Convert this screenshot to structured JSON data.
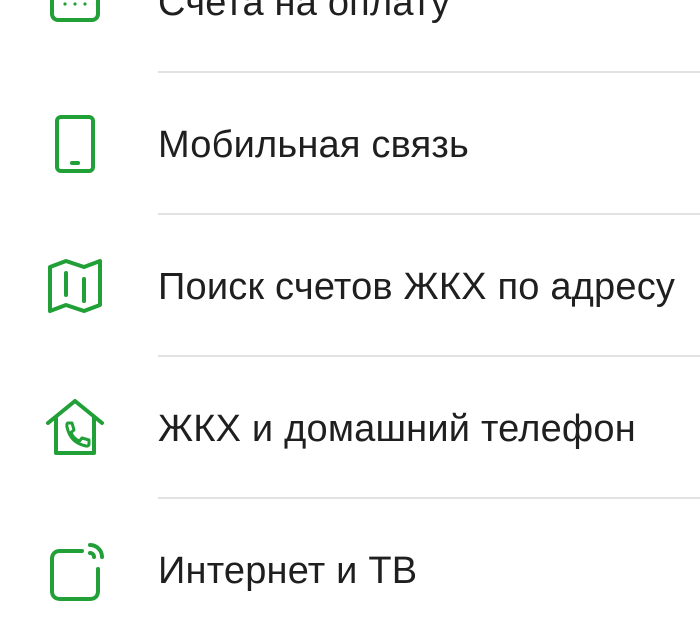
{
  "accent_color": "#21a038",
  "menu": {
    "items": [
      {
        "label": "Счета на оплату",
        "icon": "invoice-icon"
      },
      {
        "label": "Мобильная связь",
        "icon": "mobile-phone-icon"
      },
      {
        "label": "Поиск счетов ЖКХ по адресу",
        "icon": "map-icon"
      },
      {
        "label": "ЖКХ и домашний телефон",
        "icon": "house-phone-icon"
      },
      {
        "label": "Интернет и ТВ",
        "icon": "internet-tv-icon"
      }
    ]
  }
}
